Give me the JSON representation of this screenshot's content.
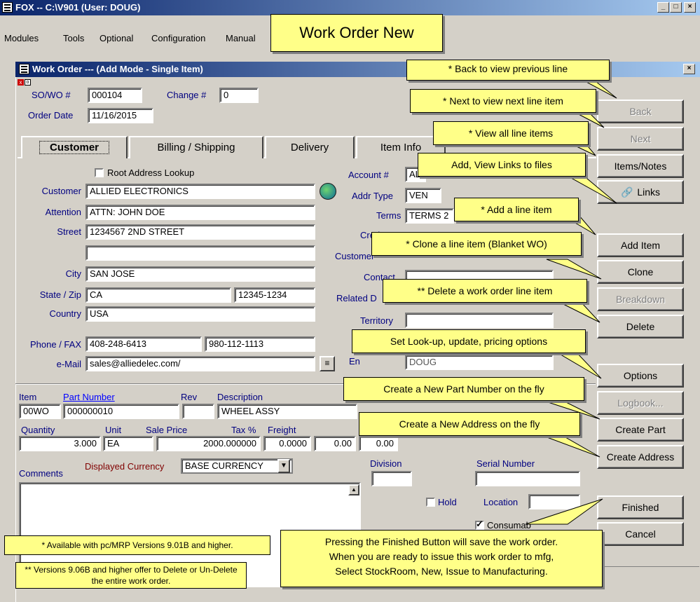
{
  "window": {
    "title": "FOX -- C:\\V901 (User: DOUG)"
  },
  "menu": [
    "Modules",
    "Tools",
    "Optional",
    "Configuration",
    "Manual"
  ],
  "banner": "Work Order New",
  "dialog": {
    "title": "Work Order --- (Add Mode - Single Item)",
    "close": "×"
  },
  "header": {
    "sowo_label": "SO/WO #",
    "sowo_value": "000104",
    "change_label": "Change #",
    "change_value": "0",
    "order_date_label": "Order Date",
    "order_date_value": "11/16/2015"
  },
  "tabs": [
    "Customer",
    "Billing / Shipping",
    "Delivery",
    "Item Info"
  ],
  "customer": {
    "root_lookup": "Root Address Lookup",
    "customer_label": "Customer",
    "customer_value": "ALLIED ELECTRONICS",
    "attention_label": "Attention",
    "attention_value": "ATTN: JOHN DOE",
    "street_label": "Street",
    "street_value": "1234567  2ND STREET",
    "street2_value": "",
    "city_label": "City",
    "city_value": "SAN JOSE",
    "statezip_label": "State / Zip",
    "state_value": "CA",
    "zip_value": "12345-1234",
    "country_label": "Country",
    "country_value": "USA",
    "phonefax_label": "Phone / FAX",
    "phone_value": "408-248-6413",
    "fax_value": "980-112-1113",
    "email_label": "e-Mail",
    "email_value": "sales@alliedelec.com/"
  },
  "right_fields": {
    "account_label": "Account #",
    "account_value": "AL",
    "addr_type_label": "Addr Type",
    "addr_type_value": "VEN",
    "terms_label": "Terms",
    "terms_value": "TERMS 2",
    "cred_label": "Cred",
    "customer_label": "Customer",
    "contact_label": "Contact",
    "related_label": "Related D",
    "territory_label": "Territory",
    "en_label": "En",
    "en_value": "DOUG"
  },
  "item": {
    "item_label": "Item",
    "part_label": "Part Number",
    "rev_label": "Rev",
    "desc_label": "Description",
    "item_value": "00WO",
    "part_value": "000000010",
    "rev_value": "",
    "desc_value": "WHEEL ASSY",
    "qty_label": "Quantity",
    "unit_label": "Unit",
    "price_label": "Sale Price",
    "tax_label": "Tax %",
    "freight_label": "Freight",
    "d_label": "D",
    "qty_value": "3.000",
    "unit_value": "EA",
    "price_value": "2000.000000",
    "tax_value": "0.0000",
    "freight_value": "0.00",
    "d_value": "0.00",
    "comments_label": "Comments",
    "currency_label": "Displayed Currency",
    "currency_value": "BASE CURRENCY",
    "division_label": "Division",
    "serial_label": "Serial Number",
    "hold_label": "Hold",
    "location_label": "Location",
    "consumable_label": "Consumab"
  },
  "buttons": {
    "back": "Back",
    "next": "Next",
    "items_notes": "Items/Notes",
    "links": "Links",
    "add_item": "Add Item",
    "clone": "Clone",
    "breakdown": "Breakdown",
    "delete": "Delete",
    "options": "Options",
    "logbook": "Logbook...",
    "create_part": "Create Part",
    "create_address": "Create Address",
    "finished": "Finished",
    "cancel": "Cancel"
  },
  "callouts": {
    "back": "* Back to view previous line",
    "next": "* Next to view next line item",
    "view_all": "* View all line items",
    "links": "Add, View Links to files",
    "add_item": "* Add a line item",
    "clone": "* Clone a line item (Blanket WO)",
    "delete": "** Delete a work order line item",
    "options": "Set Look-up, update, pricing options",
    "create_part": "Create a New Part Number on the fly",
    "create_address": "Create a New  Address on the fly",
    "finished": "Pressing the Finished Button will save the work order.\nWhen you are ready to issue this work order to mfg,\nSelect StockRoom, New, Issue to Manufacturing."
  },
  "notes": {
    "note1": "* Available with pc/MRP Versions 9.01B and higher.",
    "note2": "** Versions 9.06B and higher offer to Delete or Un-Delete the entire work order."
  }
}
